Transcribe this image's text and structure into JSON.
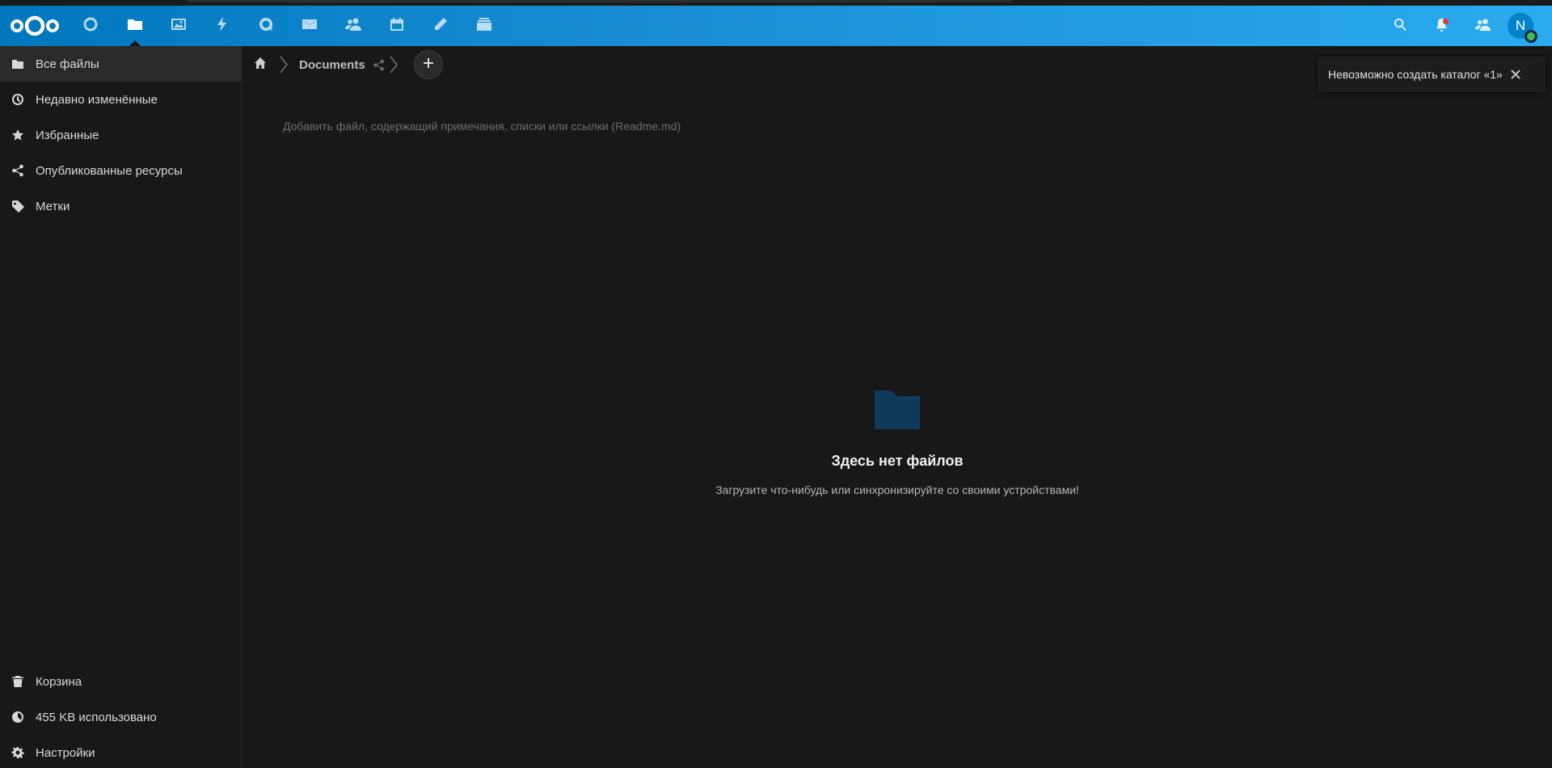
{
  "header": {
    "logo_icon": "nextcloud-logo",
    "apps": [
      {
        "name": "dashboard",
        "icon": "circle-icon"
      },
      {
        "name": "files",
        "icon": "folder-icon"
      },
      {
        "name": "photos",
        "icon": "image-icon"
      },
      {
        "name": "activity",
        "icon": "lightning-icon"
      },
      {
        "name": "talk",
        "icon": "talk-icon"
      },
      {
        "name": "mail",
        "icon": "mail-icon"
      },
      {
        "name": "contacts",
        "icon": "contacts-icon"
      },
      {
        "name": "calendar",
        "icon": "calendar-icon"
      },
      {
        "name": "notes",
        "icon": "pencil-icon"
      },
      {
        "name": "deck",
        "icon": "deck-icon"
      }
    ],
    "avatar_initial": "N",
    "accent_color": "#0082c9"
  },
  "sidebar": {
    "items": [
      {
        "label": "Все файлы",
        "icon": "folder-icon"
      },
      {
        "label": "Недавно изменённые",
        "icon": "clock-icon"
      },
      {
        "label": "Избранные",
        "icon": "star-icon"
      },
      {
        "label": "Опубликованные ресурсы",
        "icon": "share-icon"
      },
      {
        "label": "Метки",
        "icon": "tag-icon"
      }
    ],
    "bottom": {
      "trash": "Корзина",
      "quota": "455 KB использовано",
      "settings": "Настройки"
    }
  },
  "breadcrumb": {
    "current": "Documents"
  },
  "readme_placeholder": "Добавить файл, содержащий примечания, списки или ссылки (Readme.md)",
  "toast": {
    "message": "Невозможно создать каталог «1»"
  },
  "empty": {
    "title": "Здесь нет файлов",
    "subtitle": "Загрузите что-нибудь или синхронизируйте со своими устройствами!"
  }
}
